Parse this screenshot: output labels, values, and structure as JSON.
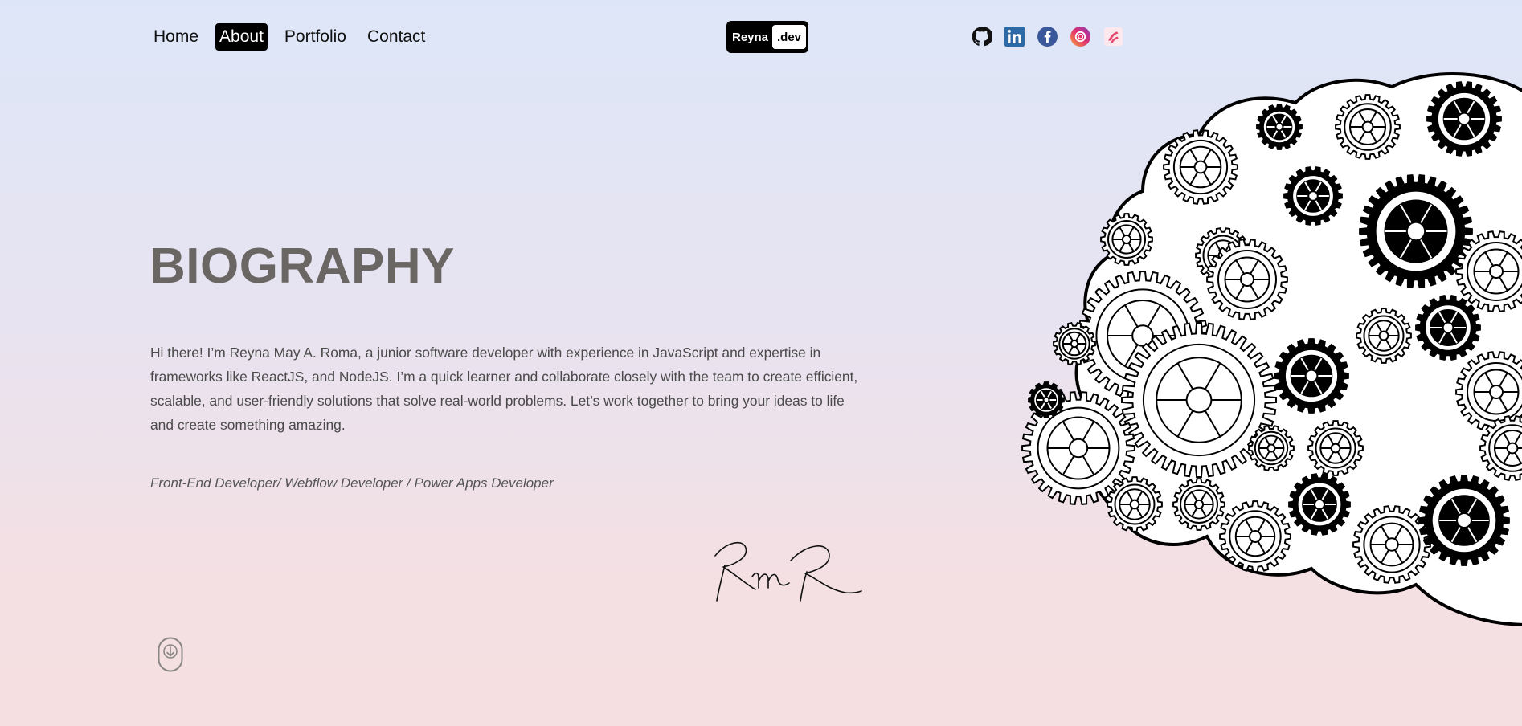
{
  "nav": {
    "items": [
      {
        "label": "Home"
      },
      {
        "label": "About"
      },
      {
        "label": "Portfolio"
      },
      {
        "label": "Contact"
      }
    ],
    "active": "About"
  },
  "logo": {
    "part1": "Reyna",
    "part2": ".dev"
  },
  "social": [
    "github-icon",
    "linkedin-icon",
    "facebook-icon",
    "instagram-icon",
    "dribbble-icon"
  ],
  "main": {
    "title": "BIOGRAPHY",
    "bio": "Hi there! I’m Reyna May A. Roma, a junior software developer with experience in JavaScript and expertise in frameworks like ReactJS, and NodeJS. I’m a quick learner and collaborate closely with the team to create efficient, scalable, and user-friendly solutions that solve real-world problems. Let’s work together to bring your ideas to life and create something amazing.",
    "roles": "Front-End Developer/ Webflow Developer / Power Apps Developer",
    "signature": "RmR"
  },
  "colors": {
    "background_top": "#dde6f8",
    "background_bottom": "#f5dfe0",
    "title": "#6a6663",
    "linkedin": "#2d6aa5",
    "facebook": "#3a5899"
  }
}
